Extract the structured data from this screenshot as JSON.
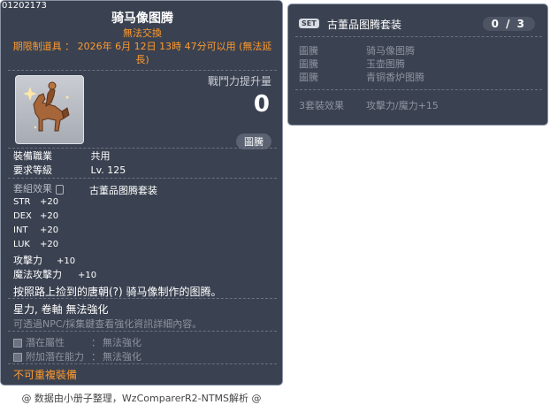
{
  "item_id": "01202173",
  "item": {
    "name": "骑马像图腾",
    "untradable": "無法交換",
    "expiry": "期限制道具 ： 2026年 6月 12日 13時 47分可以用 (無法延長)",
    "combat_power_label": "戰鬥力提升量",
    "combat_power_value": "0",
    "category_badge": "圖騰"
  },
  "requirements": [
    {
      "label": "裝備職業",
      "value": "共用"
    },
    {
      "label": "要求等級",
      "value": "Lv. 125"
    }
  ],
  "set_effect": {
    "label": "套組效果",
    "set_name": "古董品图腾套装"
  },
  "stats": [
    {
      "label": "STR",
      "value": "+20"
    },
    {
      "label": "DEX",
      "value": "+20"
    },
    {
      "label": "INT",
      "value": "+20"
    },
    {
      "label": "LUK",
      "value": "+20"
    },
    {
      "label": "攻擊力",
      "value": "+10"
    },
    {
      "label": "魔法攻擊力",
      "value": "+10"
    }
  ],
  "description": "按照路上捡到的唐朝(?) 骑马像制作的图腾。",
  "enhance": {
    "line1": "星力, 卷軸 無法強化",
    "line2": "可透過NPC/採集鍵查看強化資訊詳細內容。"
  },
  "potential": [
    {
      "label": "潛在屬性",
      "value": "無法強化"
    },
    {
      "label": "附加潛在能力",
      "value": "無法強化"
    }
  ],
  "no_duplicate": "不可重複裝備",
  "set_panel": {
    "tag": "SET",
    "title": "古董品图腾套装",
    "count": "0 / 3",
    "items": [
      {
        "type": "圖騰",
        "name": "骑马像图腾"
      },
      {
        "type": "圖騰",
        "name": "玉壶图腾"
      },
      {
        "type": "圖騰",
        "name": "青铜香炉图腾"
      }
    ],
    "bonus_label": "3套裝效果",
    "bonus_value": "攻擊力/魔力+15"
  },
  "footer": "@ 数据由小册子整理，WzComparerR2-NTMS解析 @",
  "colors": {
    "panel_bg": "#3a4150",
    "warning": "#ff9a2e",
    "muted": "#b5bac4"
  }
}
